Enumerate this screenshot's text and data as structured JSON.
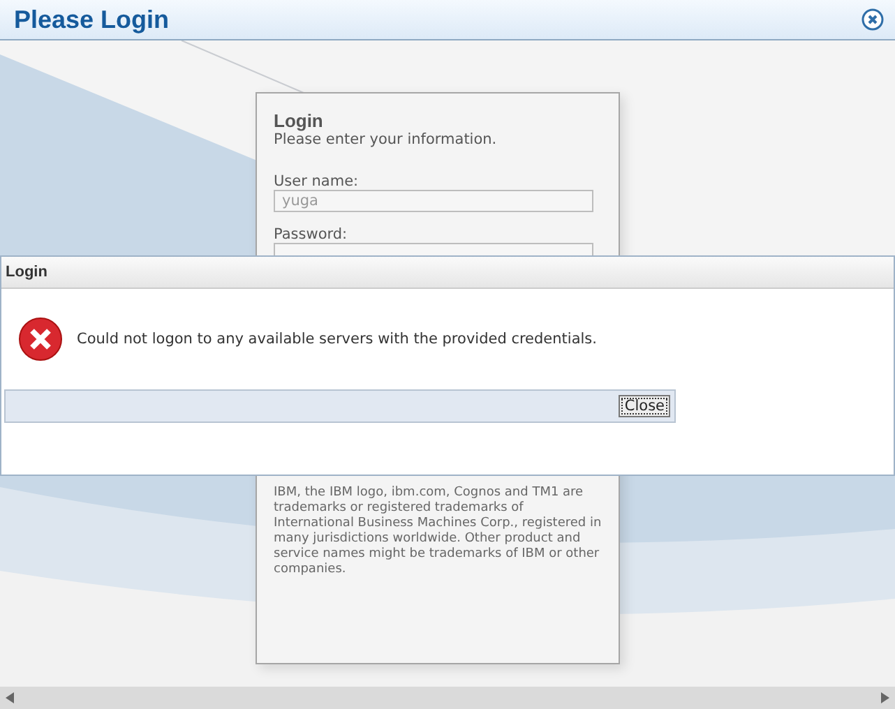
{
  "window": {
    "title": "Please Login"
  },
  "login_panel": {
    "title": "Login",
    "subtitle": "Please enter your information.",
    "fields": [
      {
        "label": "User name:",
        "value": "yuga"
      },
      {
        "label": "Password:"
      }
    ],
    "legal": "IBM, the IBM logo, ibm.com, Cognos and TM1 are trademarks or registered trademarks of International Business Machines Corp., registered in many jurisdictions worldwide. Other product and service names might be trademarks of IBM or other companies."
  },
  "dialog": {
    "title": "Login",
    "kind": "error",
    "message": "Could not logon to any available servers with the provided credentials.",
    "buttons": [
      "Close"
    ]
  }
}
